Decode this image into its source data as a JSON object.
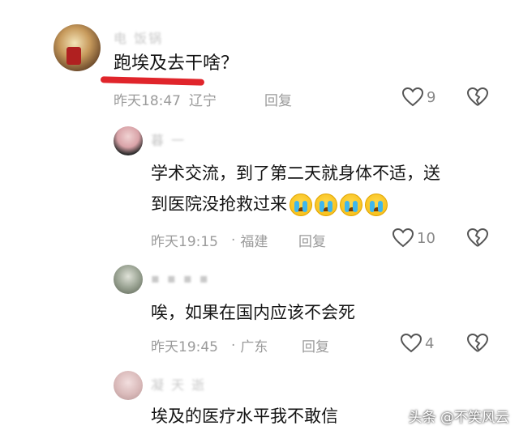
{
  "comments": [
    {
      "author": "电 饭锅",
      "text": "跑埃及去干啥？",
      "time": "昨天18:47",
      "location": "辽宁",
      "reply_label": "回复",
      "likes": "9"
    },
    {
      "author": "暮 一 ",
      "text_line1": "学术交流，到了第二天就身体不适，送",
      "text_line2": "到医院没抢救过来",
      "time": "昨天19:15",
      "location": "福建",
      "reply_label": "回复",
      "likes": "10"
    },
    {
      "author": "▪ ▪ ▪ ▪",
      "text": "唉，如果在国内应该不会死",
      "time": "昨天19:45",
      "location": "广东",
      "reply_label": "回复",
      "likes": "4"
    },
    {
      "author": "凝 天 逝",
      "text": "埃及的医疗水平我不敢信"
    }
  ],
  "emoji_names": [
    "crying-face-icon",
    "crying-face-icon",
    "crying-face-icon",
    "crying-face-icon"
  ],
  "watermark": "头条 @不笑风云",
  "colors": {
    "underline": "#e0252b",
    "meta": "#9a9a9a"
  }
}
